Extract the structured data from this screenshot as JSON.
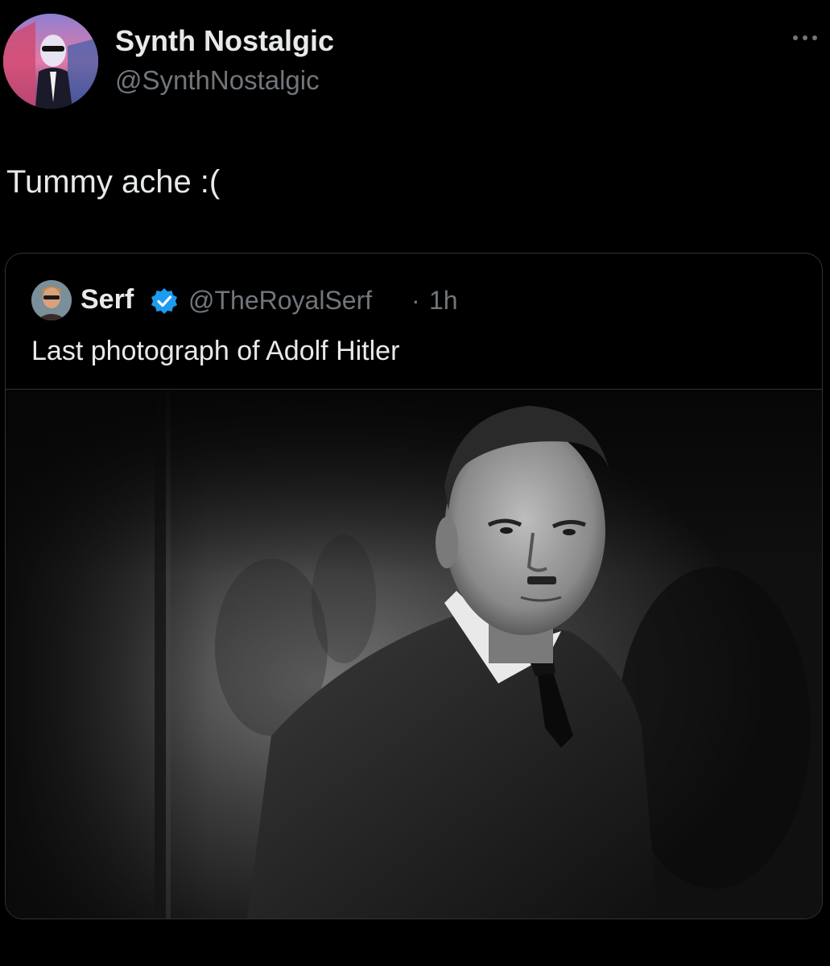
{
  "post": {
    "author": {
      "display_name": "Synth Nostalgic",
      "handle": "@SynthNostalgic",
      "avatar": "profile-avatar"
    },
    "more_icon": "more-horizontal-icon",
    "text": "Tummy ache :("
  },
  "quoted_post": {
    "author": {
      "display_name": "Serf",
      "handle": "@TheRoyalSerf",
      "verified": true,
      "avatar": "profile-avatar"
    },
    "separator": "·",
    "time": "1h",
    "text": "Last photograph of Adolf Hitler",
    "media": "black-and-white-portrait-photo"
  },
  "colors": {
    "background": "#000000",
    "primary_text": "#e7e9ea",
    "secondary_text": "#71767b",
    "border": "#2f3336",
    "verified_blue": "#1d9bf0"
  }
}
